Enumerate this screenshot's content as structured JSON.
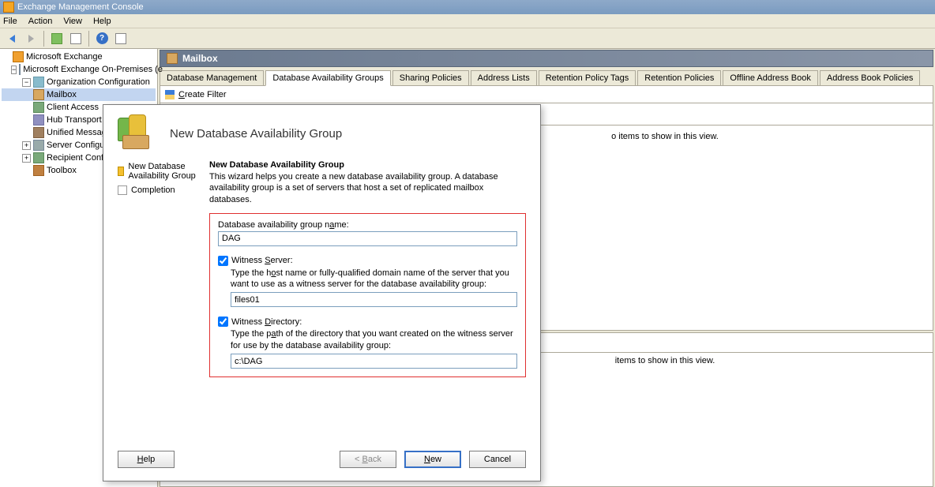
{
  "window": {
    "title": "Exchange Management Console"
  },
  "menu": {
    "file": "File",
    "action": "Action",
    "view": "View",
    "help": "Help"
  },
  "tree": {
    "root": "Microsoft Exchange",
    "onprem": "Microsoft Exchange On-Premises (e",
    "orgconfig": "Organization Configuration",
    "mailbox": "Mailbox",
    "clientaccess": "Client Access",
    "hubtransport": "Hub Transport",
    "unifiedmsg": "Unified Messag",
    "serverconfig": "Server Configurati",
    "recipientconfig": "Recipient Configura",
    "toolbox": "Toolbox"
  },
  "content": {
    "header": "Mailbox",
    "tabs": {
      "t1": "Database Management",
      "t2": "Database Availability Groups",
      "t3": "Sharing Policies",
      "t4": "Address Lists",
      "t5": "Retention Policy Tags",
      "t6": "Retention Policies",
      "t7": "Offline Address Book",
      "t8": "Address Book Policies"
    },
    "filter_label": "Create Filter",
    "empty1": "o items to show in this view.",
    "empty2": "items to show in this view."
  },
  "dialog": {
    "title": "New Database Availability Group",
    "steps": {
      "s1": "New Database Availability Group",
      "s2": "Completion"
    },
    "form_title": "New Database Availability Group",
    "form_intro": "This wizard helps you create a new database availability group. A database availability group is a set of servers that host a set of replicated mailbox databases.",
    "name_label": "Database availability group name:",
    "name_value": "DAG",
    "witness_server_label": "Witness Server:",
    "witness_server_help": "Type the host name or fully-qualified domain name of the server that you want to use as a witness server for the database availability group:",
    "witness_server_value": "files01",
    "witness_dir_label": "Witness Directory:",
    "witness_dir_help": "Type the path of the directory that you want created on the witness server for use by the database availability group:",
    "witness_dir_value": "c:\\DAG",
    "buttons": {
      "help": "Help",
      "back": "< Back",
      "new": "New",
      "cancel": "Cancel"
    }
  }
}
